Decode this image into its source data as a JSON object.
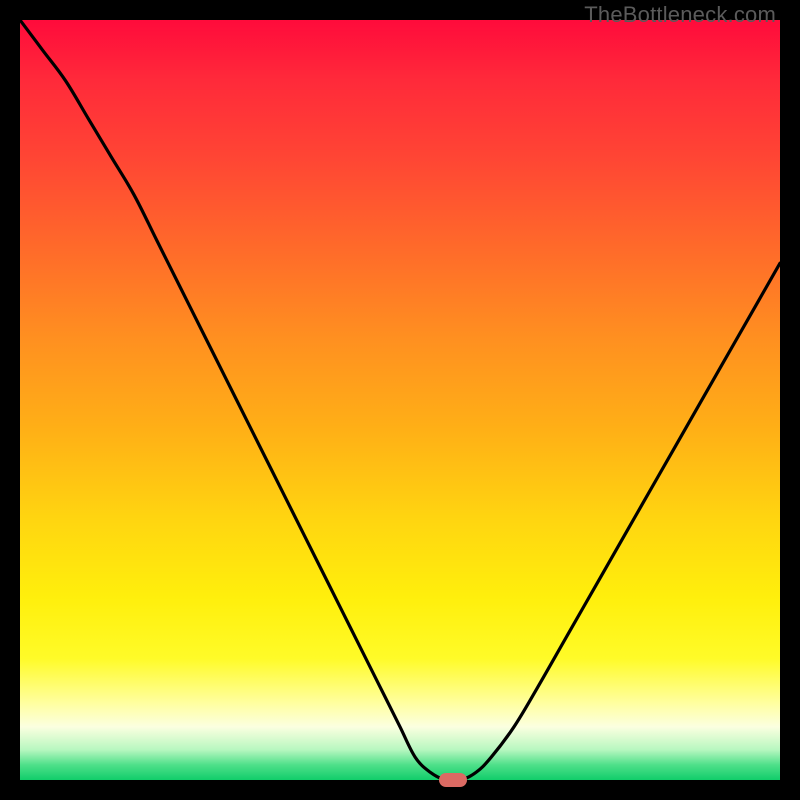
{
  "watermark": "TheBottleneck.com",
  "chart_data": {
    "type": "line",
    "title": "",
    "xlabel": "",
    "ylabel": "",
    "xlim": [
      0,
      100
    ],
    "ylim": [
      0,
      100
    ],
    "grid": false,
    "legend": false,
    "series": [
      {
        "name": "bottleneck-curve",
        "x": [
          0,
          3,
          6,
          9,
          12,
          15,
          18,
          21,
          24,
          27,
          30,
          33,
          36,
          39,
          42,
          45,
          48,
          50,
          52,
          54,
          56,
          58,
          60,
          62,
          65,
          68,
          72,
          76,
          80,
          84,
          88,
          92,
          96,
          100
        ],
        "y": [
          100,
          96,
          92,
          87,
          82,
          77,
          71,
          65,
          59,
          53,
          47,
          41,
          35,
          29,
          23,
          17,
          11,
          7,
          3,
          1,
          0,
          0,
          1,
          3,
          7,
          12,
          19,
          26,
          33,
          40,
          47,
          54,
          61,
          68
        ]
      }
    ],
    "marker": {
      "x": 57,
      "y": 0,
      "color": "#db6a63",
      "shape": "pill"
    },
    "background_gradient": {
      "stops": [
        {
          "pct": 0,
          "color": "#ff0b3b"
        },
        {
          "pct": 8,
          "color": "#ff2a3a"
        },
        {
          "pct": 18,
          "color": "#ff4534"
        },
        {
          "pct": 30,
          "color": "#ff6a2a"
        },
        {
          "pct": 42,
          "color": "#ff9020"
        },
        {
          "pct": 54,
          "color": "#ffb016"
        },
        {
          "pct": 66,
          "color": "#ffd610"
        },
        {
          "pct": 76,
          "color": "#ffef0c"
        },
        {
          "pct": 84,
          "color": "#fffb28"
        },
        {
          "pct": 90,
          "color": "#ffffa2"
        },
        {
          "pct": 93,
          "color": "#fbffe0"
        },
        {
          "pct": 96,
          "color": "#b8f7c0"
        },
        {
          "pct": 98,
          "color": "#4fe08a"
        },
        {
          "pct": 100,
          "color": "#11cd6a"
        }
      ]
    }
  }
}
